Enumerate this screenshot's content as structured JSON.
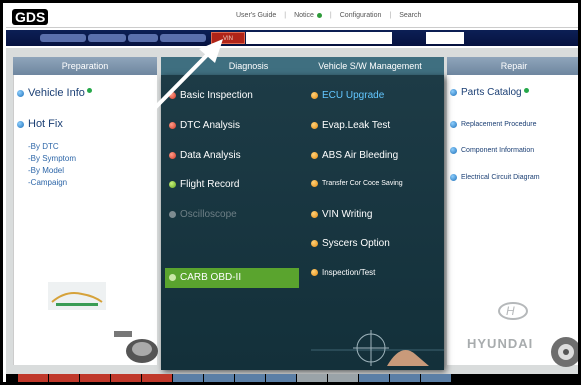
{
  "header": {
    "logo": "GDS",
    "nav": [
      {
        "label": "User's Guide"
      },
      {
        "label": "Notice"
      },
      {
        "label": "Configuration"
      },
      {
        "label": "Search"
      }
    ]
  },
  "toolbar": {
    "vin_label": "VIN"
  },
  "columns": {
    "preparation": "Preparation",
    "diagnosis": "Diagnosis",
    "vehicle_sw": "Vehicle S/W Management",
    "repair": "Repair"
  },
  "preparation": {
    "vehicle_info": "Vehicle Info",
    "hot_fix": "Hot Fix",
    "sub_items": [
      "-By DTC",
      "-By Symptom",
      "-By Model",
      "-Campaign"
    ]
  },
  "diagnosis": {
    "items": [
      {
        "label": "Basic Inspection",
        "color": "#d23b26"
      },
      {
        "label": "DTC Analysis",
        "color": "#d23b26"
      },
      {
        "label": "Data Analysis",
        "color": "#d23b26"
      },
      {
        "label": "Flight Record",
        "color": "#66a81e"
      },
      {
        "label": "Oscilloscope",
        "color": "#7d8b90"
      },
      {
        "label": "CARB OBD-II",
        "color": "#66a81e"
      }
    ]
  },
  "vehicle_sw": {
    "items": [
      {
        "label": "ECU Upgrade"
      },
      {
        "label": "Evap.Leak Test"
      },
      {
        "label": "ABS Air Bleeding"
      },
      {
        "label": "Transfer Cor Coce Saving"
      },
      {
        "label": "VIN Writing"
      },
      {
        "label": "Syscers Option"
      },
      {
        "label": "Inspection/Test"
      }
    ]
  },
  "repair": {
    "items": [
      {
        "label": "Parts Catalog"
      },
      {
        "label": "Replacement Procedure"
      },
      {
        "label": "Component Information"
      },
      {
        "label": "Electrical Circuit Diagram"
      }
    ]
  },
  "branding": {
    "hyundai_mark": "H",
    "hyundai_word": "HYUNDAI"
  },
  "colors": {
    "accent_dark": "#1d3b46",
    "vin_red": "#b02418",
    "active_green": "#5aa42e"
  }
}
